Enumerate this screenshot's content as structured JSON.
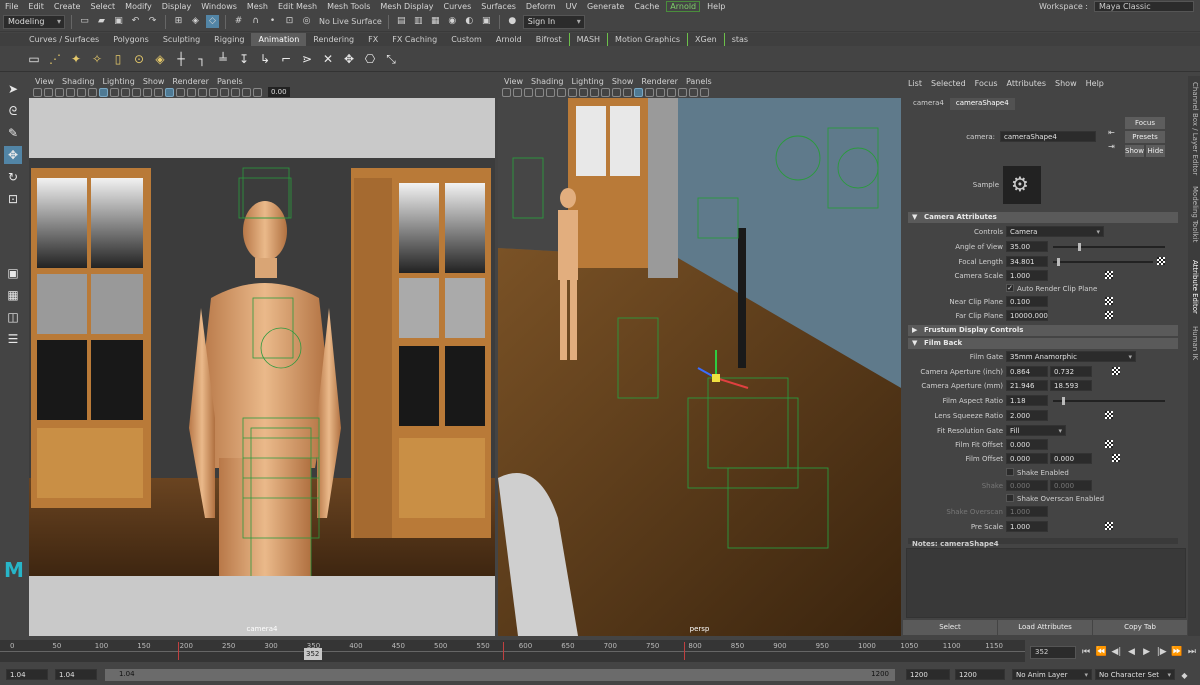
{
  "menubar": {
    "items": [
      "File",
      "Edit",
      "Create",
      "Select",
      "Modify",
      "Display",
      "Windows",
      "Mesh",
      "Edit Mesh",
      "Mesh Tools",
      "Mesh Display",
      "Curves",
      "Surfaces",
      "Deform",
      "UV",
      "Generate",
      "Cache",
      "Arnold",
      "Help"
    ],
    "workspace_label": "Workspace :",
    "workspace_value": "Maya Classic"
  },
  "statusline": {
    "mode": "Modeling",
    "live_surface": "No Live Surface",
    "sign_in": "Sign In"
  },
  "shelf": {
    "tabs": [
      "Curves / Surfaces",
      "Polygons",
      "Sculpting",
      "Rigging",
      "Animation",
      "Rendering",
      "FX",
      "FX Caching",
      "Custom",
      "Arnold",
      "Bifrost",
      "MASH",
      "Motion Graphics",
      "XGen",
      "stas"
    ],
    "active_tab": "Animation"
  },
  "viewport_left": {
    "menu": [
      "View",
      "Shading",
      "Lighting",
      "Show",
      "Renderer",
      "Panels"
    ],
    "number": "0.00",
    "camera_label": "camera4"
  },
  "viewport_right": {
    "menu": [
      "View",
      "Shading",
      "Lighting",
      "Show",
      "Renderer",
      "Panels"
    ],
    "camera_label": "persp"
  },
  "attribute_editor": {
    "menu": [
      "List",
      "Selected",
      "Focus",
      "Attributes",
      "Show",
      "Help"
    ],
    "tabs": [
      "camera4",
      "cameraShape4"
    ],
    "active_tab": "cameraShape4",
    "camera_label": "camera:",
    "camera_value": "cameraShape4",
    "buttons": {
      "focus": "Focus",
      "presets": "Presets",
      "show": "Show",
      "hide": "Hide"
    },
    "sample_label": "Sample",
    "sections": {
      "camera_attributes": "Camera Attributes",
      "frustum": "Frustum Display Controls",
      "film_back": "Film Back"
    },
    "fields": {
      "controls_label": "Controls",
      "controls_value": "Camera",
      "aov_label": "Angle of View",
      "aov_value": "35.00",
      "focal_label": "Focal Length",
      "focal_value": "34.801",
      "scale_label": "Camera Scale",
      "scale_value": "1.000",
      "auto_clip_label": "Auto Render Clip Plane",
      "near_label": "Near Clip Plane",
      "near_value": "0.100",
      "far_label": "Far Clip Plane",
      "far_value": "10000.000",
      "gate_label": "Film Gate",
      "gate_value": "35mm Anamorphic",
      "ap_in_label": "Camera Aperture (inch)",
      "ap_in_1": "0.864",
      "ap_in_2": "0.732",
      "ap_mm_label": "Camera Aperture (mm)",
      "ap_mm_1": "21.946",
      "ap_mm_2": "18.593",
      "far_ratio_label": "Film Aspect Ratio",
      "far_ratio_value": "1.18",
      "squeeze_label": "Lens Squeeze Ratio",
      "squeeze_value": "2.000",
      "res_gate_label": "Fit Resolution Gate",
      "res_gate_value": "Fill",
      "fit_offset_label": "Film Fit Offset",
      "fit_offset_value": "0.000",
      "film_offset_label": "Film Offset",
      "film_offset_1": "0.000",
      "film_offset_2": "0.000",
      "shake_enabled_label": "Shake Enabled",
      "shake_label": "Shake",
      "shake_1": "0.000",
      "shake_2": "0.000",
      "shake_overscan_enabled_label": "Shake Overscan Enabled",
      "shake_overscan_label": "Shake Overscan",
      "shake_overscan_value": "1.000",
      "prescale_label": "Pre Scale",
      "prescale_value": "1.000"
    },
    "notes_label": "Notes:",
    "notes_value": "cameraShape4",
    "bottom_buttons": [
      "Select",
      "Load Attributes",
      "Copy Tab"
    ],
    "side_tabs": [
      "Channel Box / Layer Editor",
      "Modeling Toolkit",
      "Attribute Editor",
      "Human IK"
    ]
  },
  "timeline": {
    "ticks": [
      "0",
      "50",
      "100",
      "150",
      "200",
      "250",
      "300",
      "350",
      "400",
      "450",
      "500",
      "550",
      "600",
      "650",
      "700",
      "750",
      "800",
      "850",
      "900",
      "950",
      "1000",
      "1050",
      "1100",
      "1150"
    ],
    "current_frame_marker": "352",
    "current_frame_field": "352"
  },
  "range": {
    "start": "1.04",
    "start2": "1.04",
    "range_start": "1.04",
    "range_end": "1200",
    "end1": "1200",
    "end2": "1200",
    "anim_layer": "No Anim Layer",
    "char_set": "No Character Set"
  }
}
